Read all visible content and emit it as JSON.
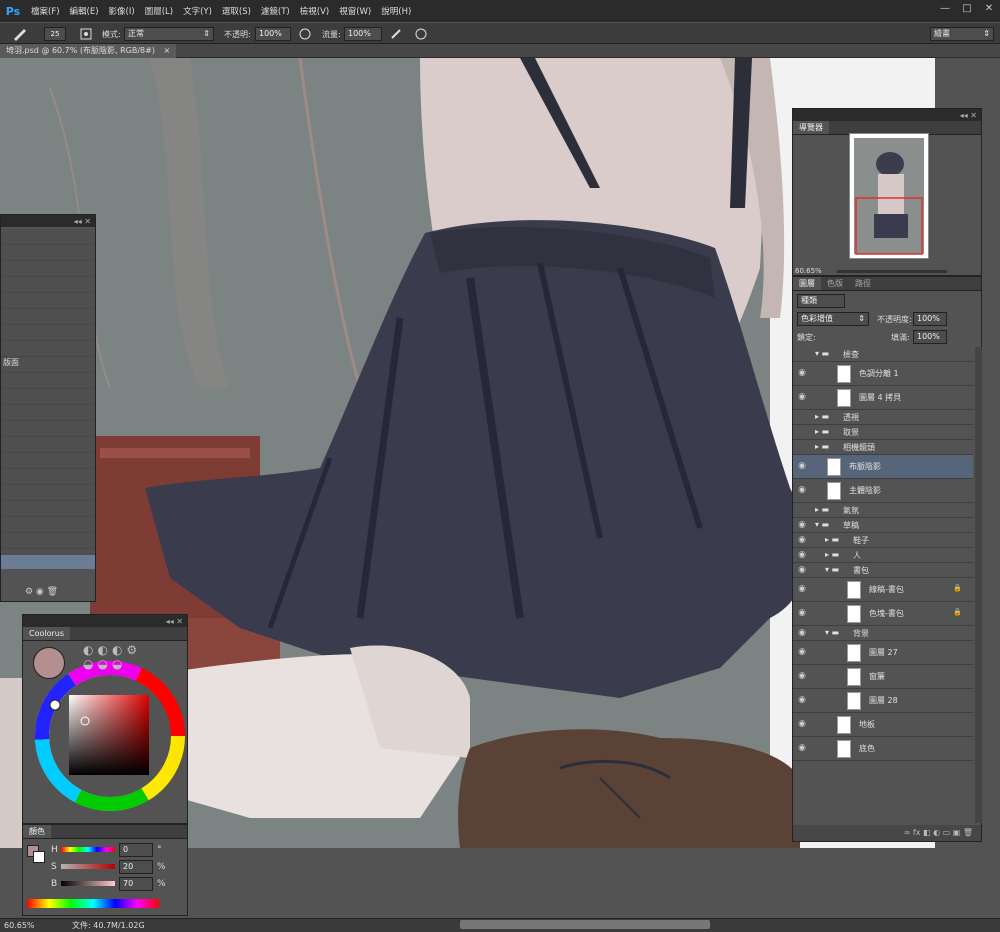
{
  "app": {
    "logo": "Ps"
  },
  "menu": [
    "檔案(F)",
    "編輯(E)",
    "影像(I)",
    "圖層(L)",
    "文字(Y)",
    "選取(S)",
    "濾鏡(T)",
    "檢視(V)",
    "視窗(W)",
    "說明(H)"
  ],
  "window_controls": [
    "—",
    "□",
    "✕"
  ],
  "options": {
    "brush_size": "25",
    "mode_label": "模式:",
    "mode_value": "正常",
    "opacity_label": "不透明:",
    "opacity_value": "100%",
    "flow_label": "流量:",
    "flow_value": "100%",
    "workspace": "繪畫"
  },
  "document_tab": {
    "title": "埼羽.psd @ 60.7% (布脈陰影, RGB/8#)",
    "close": "×"
  },
  "navigator": {
    "tabs": [
      "導覽器"
    ],
    "zoom": "60.65%"
  },
  "layers_panel": {
    "tabs": [
      "圖層",
      "色版",
      "路徑"
    ],
    "filter": "種類",
    "blend_mode": "色彩增值",
    "opacity_label": "不透明度:",
    "opacity_value": "100%",
    "lock_label": "鎖定:",
    "fill_label": "填滿:",
    "fill_value": "100%",
    "layers": [
      {
        "name": "檢查",
        "type": "group-open",
        "indent": 0
      },
      {
        "name": "色調分離 1",
        "type": "adjust",
        "indent": 1
      },
      {
        "name": "圖層 4 拷貝",
        "type": "layer",
        "indent": 1
      },
      {
        "name": "透視",
        "type": "group",
        "indent": 0
      },
      {
        "name": "取景",
        "type": "group",
        "indent": 0
      },
      {
        "name": "相機鏡頭",
        "type": "group",
        "indent": 0
      },
      {
        "name": "布脈陰影",
        "type": "layer",
        "indent": 0,
        "selected": true
      },
      {
        "name": "主體陰影",
        "type": "layer",
        "indent": 0
      },
      {
        "name": "氣氛",
        "type": "group",
        "indent": 0
      },
      {
        "name": "草稿",
        "type": "group-open",
        "indent": 0
      },
      {
        "name": "鞋子",
        "type": "group",
        "indent": 1
      },
      {
        "name": "人",
        "type": "group",
        "indent": 1
      },
      {
        "name": "書包",
        "type": "group-open",
        "indent": 1
      },
      {
        "name": "線稿-書包",
        "type": "layer",
        "indent": 2,
        "locked": true
      },
      {
        "name": "色塊-書包",
        "type": "layer",
        "indent": 2,
        "locked": true
      },
      {
        "name": "背景",
        "type": "group-open",
        "indent": 1
      },
      {
        "name": "圖層 27",
        "type": "layer",
        "indent": 2
      },
      {
        "name": "窗簾",
        "type": "layer",
        "indent": 2
      },
      {
        "name": "圖層 28",
        "type": "layer",
        "indent": 2
      },
      {
        "name": "地板",
        "type": "layer",
        "indent": 1
      },
      {
        "name": "底色",
        "type": "layer",
        "indent": 1
      }
    ]
  },
  "left_panel": {
    "visible_text": "版面"
  },
  "coolorus": {
    "title": "Coolorus"
  },
  "color_panel": {
    "title": "顏色",
    "h_label": "H",
    "h_value": "0",
    "h_unit": "°",
    "s_label": "S",
    "s_value": "20",
    "s_unit": "%",
    "b_label": "B",
    "b_value": "70",
    "b_unit": "%"
  },
  "status": {
    "zoom": "60.65%",
    "file_info": "文件: 40.7M/1.02G"
  },
  "colors": {
    "current_color": "#b38f8f",
    "skirt": "#3a3c4d",
    "background": "#7a8281"
  }
}
